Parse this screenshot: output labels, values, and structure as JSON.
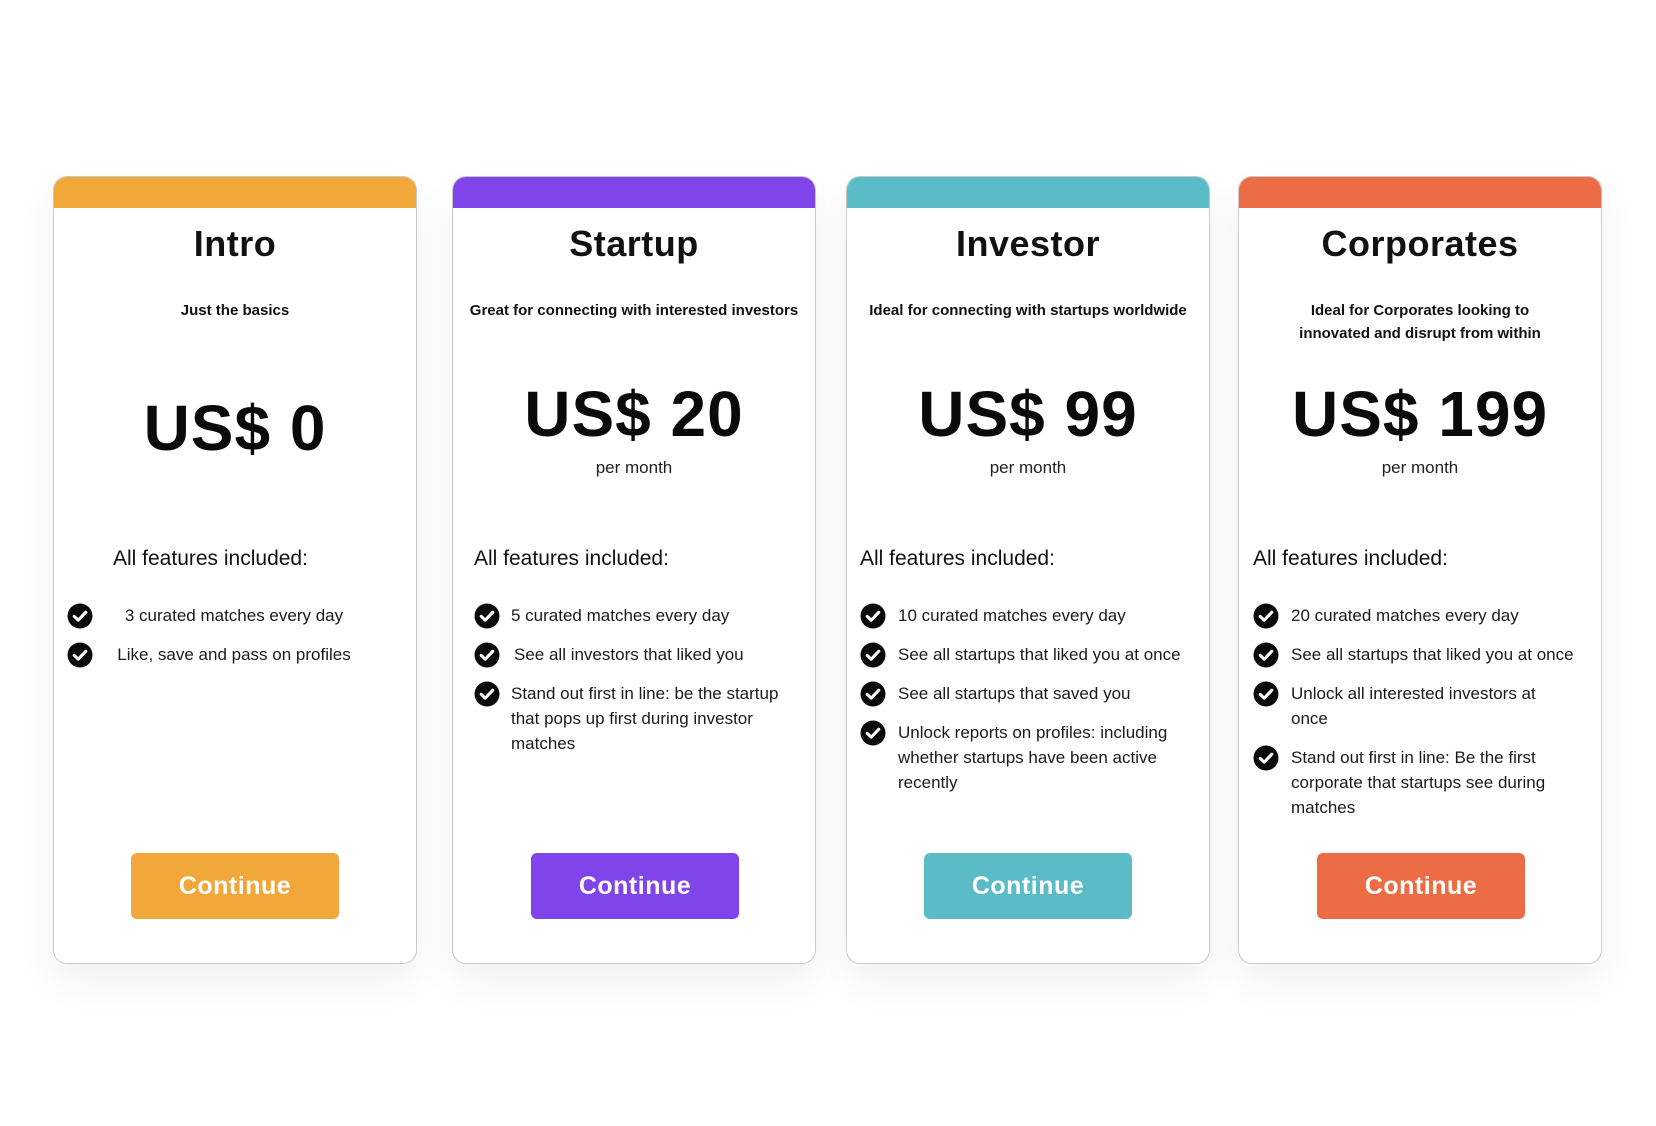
{
  "plans": [
    {
      "title": "Intro",
      "subtitle": "Just the basics",
      "price": "US$ 0",
      "period": "",
      "features_heading": "All features included:",
      "features": [
        "3 curated matches every day",
        "Like, save and pass on profiles"
      ],
      "button_label": "Continue",
      "accent_color": "#F2A73B"
    },
    {
      "title": "Startup",
      "subtitle": "Great for connecting with interested investors",
      "price": "US$ 20",
      "period": "per month",
      "features_heading": "All features included:",
      "features": [
        "5 curated matches every day",
        "See all investors that liked you",
        "Stand out first in line: be the startup that pops up first during investor matches"
      ],
      "button_label": "Continue",
      "accent_color": "#7F44EA"
    },
    {
      "title": "Investor",
      "subtitle": "Ideal for connecting with startups worldwide",
      "price": "US$ 99",
      "period": "per month",
      "features_heading": "All features included:",
      "features": [
        "10 curated matches every day",
        "See all startups that liked you at once",
        "See all startups that saved you",
        "Unlock reports on profiles: including whether startups have been active recently"
      ],
      "button_label": "Continue",
      "accent_color": "#5BBBC7"
    },
    {
      "title": "Corporates",
      "subtitle": "Ideal for Corporates looking to innovated and disrupt from within",
      "price": "US$ 199",
      "period": "per month",
      "features_heading": "All features included:",
      "features": [
        "20 curated matches every day",
        "See all startups that liked you at once",
        "Unlock all interested investors at once",
        "Stand out first in line: Be the first corporate that startups see during matches"
      ],
      "button_label": "Continue",
      "accent_color": "#EC6C45"
    }
  ],
  "icons": {
    "check": "check-circle-icon"
  }
}
